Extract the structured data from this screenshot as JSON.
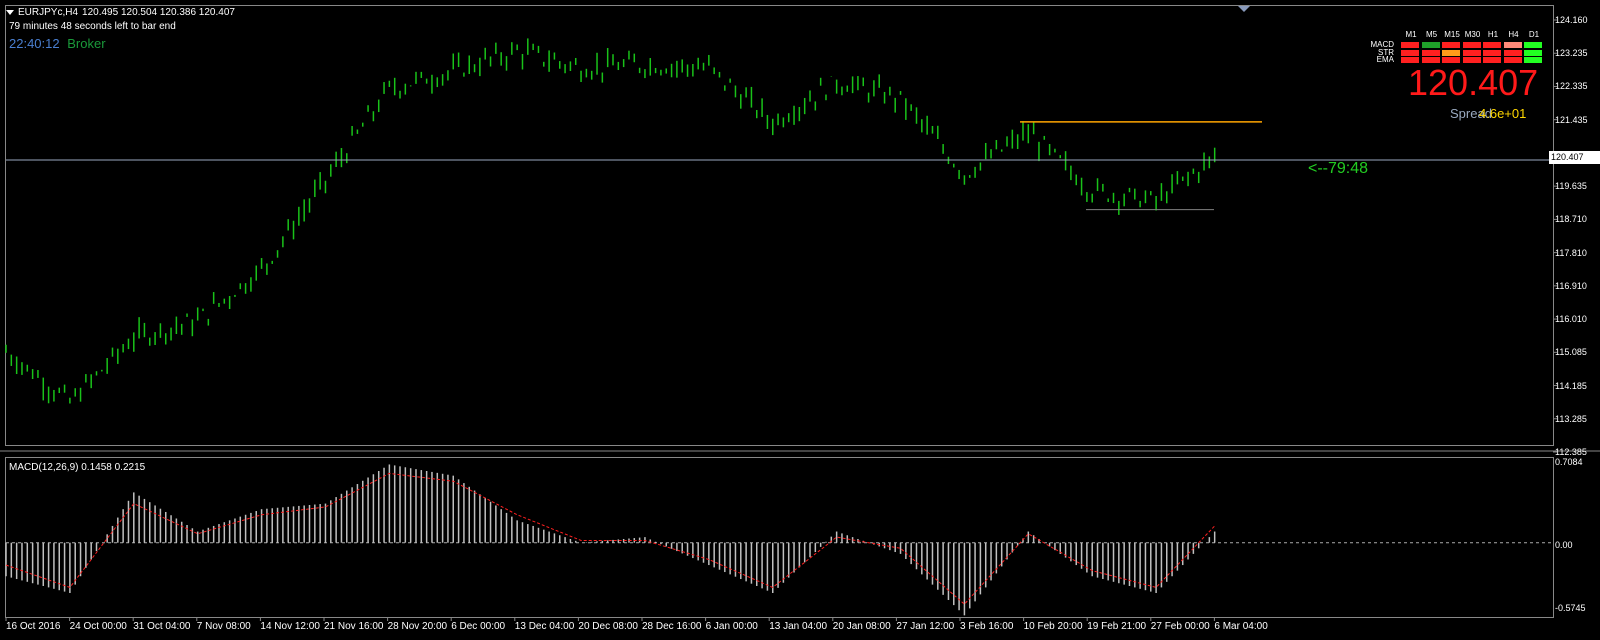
{
  "header": {
    "symbol": "EURJPYc,H4",
    "ohlc": "120.495 120.504 120.386 120.407",
    "bar_timer": "79 minutes 48 seconds left to bar end",
    "clock": "22:40:12",
    "broker": "Broker"
  },
  "signal_panel": {
    "timeframes": [
      "M1",
      "M5",
      "M15",
      "M30",
      "H1",
      "H4",
      "D1"
    ],
    "rows": [
      {
        "name": "MACD",
        "states": [
          "red",
          "green",
          "red",
          "red",
          "red",
          "salmon",
          "lime"
        ]
      },
      {
        "name": "STR",
        "states": [
          "red",
          "red",
          "orange",
          "red",
          "red",
          "red",
          "lime"
        ]
      },
      {
        "name": "EMA",
        "states": [
          "red",
          "red",
          "red",
          "red",
          "red",
          "red",
          "lime"
        ]
      }
    ],
    "colors": {
      "red": "#ff2020",
      "green": "#1fa02a",
      "orange": "#ff9a1a",
      "salmon": "#ff8a7a",
      "lime": "#22ff22"
    }
  },
  "price_display": {
    "big_price": "120.407",
    "spread_label": "Spread",
    "spread_value": "4.6e+01",
    "countdown": "<--79:48"
  },
  "price_axis": {
    "labels": [
      "124.160",
      "123.235",
      "122.335",
      "121.435",
      "120.407",
      "119.635",
      "118.710",
      "117.810",
      "116.910",
      "116.010",
      "115.085",
      "114.185",
      "113.285",
      "112.385"
    ],
    "current_price_box": "120.407"
  },
  "macd_panel": {
    "label": "MACD(12,26,9) 0.1458 0.2215",
    "axis_labels": [
      "0.7084",
      "0.00",
      "-0.5745"
    ]
  },
  "time_axis": {
    "labels": [
      "16 Oct 2016",
      "24 Oct 00:00",
      "31 Oct 04:00",
      "7 Nov 08:00",
      "14 Nov 12:00",
      "21 Nov 16:00",
      "28 Nov 20:00",
      "6 Dec 00:00",
      "13 Dec 04:00",
      "20 Dec 08:00",
      "28 Dec 16:00",
      "6 Jan 00:00",
      "13 Jan 04:00",
      "20 Jan 08:00",
      "27 Jan 12:00",
      "3 Feb 16:00",
      "10 Feb 20:00",
      "19 Feb 21:00",
      "27 Feb 00:00",
      "6 Mar 04:00"
    ]
  },
  "chart_data": {
    "type": "line",
    "title": "EURJPYc,H4",
    "ylim": [
      112.0,
      124.6
    ],
    "macd_ylim": [
      -0.62,
      0.74
    ],
    "x": [
      "16 Oct 2016",
      "24 Oct 00:00",
      "31 Oct 04:00",
      "7 Nov 08:00",
      "14 Nov 12:00",
      "21 Nov 16:00",
      "28 Nov 20:00",
      "6 Dec 00:00",
      "13 Dec 04:00",
      "20 Dec 08:00",
      "28 Dec 16:00",
      "6 Jan 00:00",
      "13 Jan 04:00",
      "20 Jan 08:00",
      "27 Jan 12:00",
      "3 Feb 16:00",
      "10 Feb 20:00",
      "19 Feb 21:00",
      "27 Feb 00:00",
      "6 Mar 04:00"
    ],
    "series": [
      {
        "name": "EURJPYc",
        "values": [
          114.6,
          113.1,
          115.0,
          115.5,
          117.0,
          119.6,
          122.3,
          122.8,
          123.4,
          122.9,
          123.0,
          122.9,
          121.3,
          122.5,
          122.0,
          119.8,
          121.0,
          119.3,
          119.0,
          120.4
        ]
      },
      {
        "name": "MACD",
        "values": [
          -0.3,
          -0.45,
          0.45,
          0.1,
          0.3,
          0.35,
          0.7,
          0.6,
          0.2,
          0.0,
          0.05,
          -0.2,
          -0.45,
          0.1,
          -0.1,
          -0.65,
          0.1,
          -0.3,
          -0.45,
          0.15
        ]
      },
      {
        "name": "MACD signal",
        "values": [
          -0.2,
          -0.4,
          0.35,
          0.08,
          0.25,
          0.32,
          0.62,
          0.55,
          0.25,
          0.02,
          0.02,
          -0.15,
          -0.4,
          0.05,
          -0.05,
          -0.55,
          0.08,
          -0.25,
          -0.4,
          0.2
        ]
      }
    ],
    "levels": [
      {
        "value": 121.32,
        "color": "#ffa500"
      },
      {
        "value": 118.75,
        "color": "#808080"
      },
      {
        "value": 120.407,
        "color": "#9aa8c0"
      }
    ],
    "colors": {
      "candles": "#19c219",
      "macd_bars": "#c0c0c0",
      "macd_signal": "#ff2020"
    },
    "grid": false
  }
}
